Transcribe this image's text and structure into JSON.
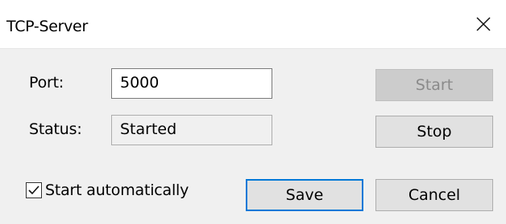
{
  "window": {
    "title": "TCP-Server",
    "close_icon": "close-icon"
  },
  "form": {
    "port_label": "Port:",
    "port_value": "5000",
    "status_label": "Status:",
    "status_value": "Started"
  },
  "buttons": {
    "start": "Start",
    "stop": "Stop",
    "save": "Save",
    "cancel": "Cancel"
  },
  "options": {
    "auto_start_label": "Start automatically",
    "auto_start_checked": true
  },
  "colors": {
    "focus_accent": "#0078d7",
    "disabled_button": "#cccccc"
  }
}
